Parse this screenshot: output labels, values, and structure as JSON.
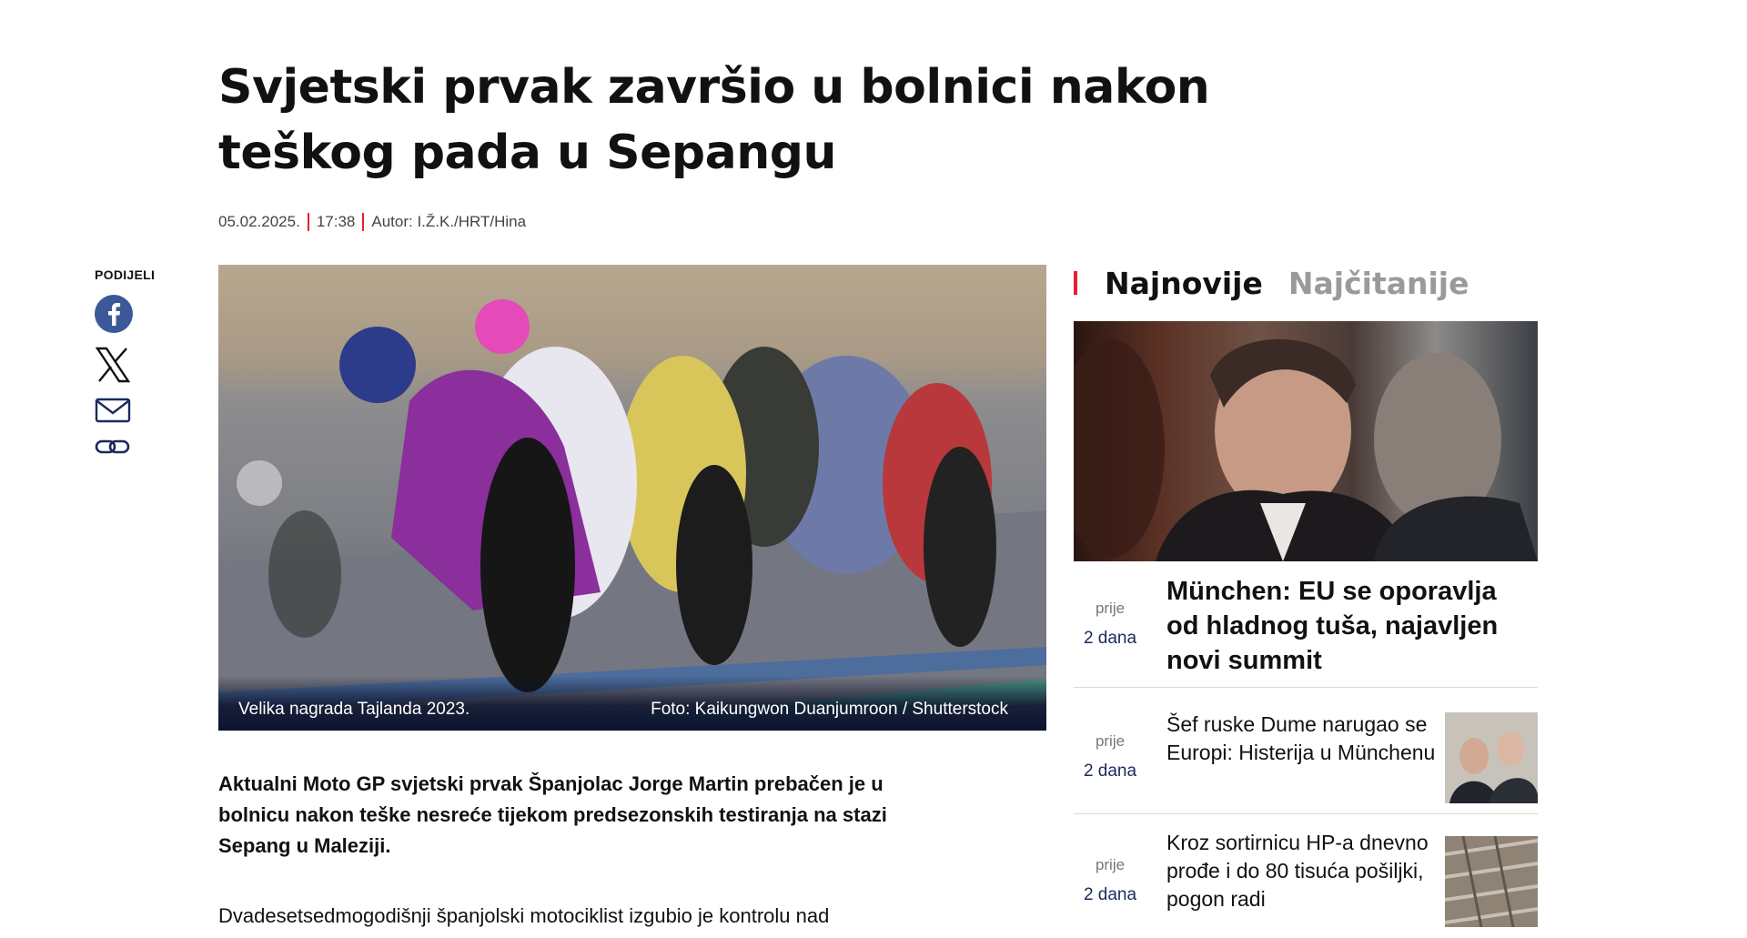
{
  "article": {
    "title": "Svjetski prvak završio u bolnici nakon teškog pada u Sepangu",
    "date": "05.02.2025.",
    "time": "17:38",
    "author": "Autor: I.Ž.K./HRT/Hina",
    "share_label": "PODIJELI",
    "share_icons": [
      "facebook-icon",
      "x-icon",
      "mail-icon",
      "link-icon"
    ],
    "image_caption": "Velika nagrada Tajlanda 2023.",
    "image_credit": "Foto: Kaikungwon Duanjumroon / Shutterstock",
    "lead_before": "Aktualni Moto GP svjetski prvak Španjolac ",
    "lead_name": "Jorge Martin",
    "lead_after": " prebačen je u bolnicu nakon teške nesreće tijekom predsezonskih testiranja na stazi Sepang u Maleziji.",
    "body_start": "Dvadesetsedmogodišnji španjolski motociklist izgubio je kontrolu nad"
  },
  "sidebar": {
    "tabs": [
      {
        "label": "Najnovije",
        "active": true
      },
      {
        "label": "Najčitanije",
        "active": false
      }
    ],
    "items": [
      {
        "when_1": "prije",
        "when_2": "2 dana",
        "headline": "München: EU se oporavlja od hladnog tuša, najavljen novi summit"
      },
      {
        "when_1": "prije",
        "when_2": "2 dana",
        "headline": "Šef ruske Dume narugao se Europi: Histerija u Münchenu"
      },
      {
        "when_1": "prije",
        "when_2": "2 dana",
        "headline": "Kroz sortirnicu HP-a dnevno prođe i do 80 tisuća pošiljki, pogon radi"
      }
    ]
  },
  "colors": {
    "accent": "#e5202e",
    "time_blue": "#1b2a5c",
    "facebook": "#3b5998"
  }
}
